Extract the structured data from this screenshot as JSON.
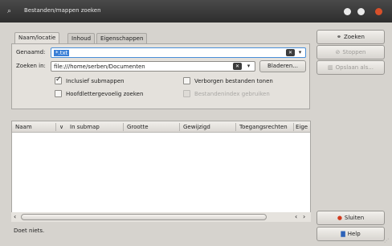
{
  "window": {
    "title": "Bestanden/mappen zoeken",
    "app_icon": "search-window-icon",
    "controls": [
      "minimize-icon",
      "maximize-icon",
      "close-icon"
    ]
  },
  "tabs": [
    {
      "label": "Naam/locatie",
      "active": true
    },
    {
      "label": "Inhoud",
      "active": false
    },
    {
      "label": "Eigenschappen",
      "active": false
    }
  ],
  "form": {
    "name_label": "Genaamd:",
    "name_value": "*.txt",
    "lookin_label": "Zoeken in:",
    "lookin_value": "file:///home/serben/Documenten",
    "browse_button": "Bladeren...",
    "include_subfolders": {
      "label": "Inclusief submappen",
      "checked": true
    },
    "case_sensitive": {
      "label": "Hoofdlettergevoelig zoeken",
      "checked": false
    },
    "hidden_files": {
      "label": "Verborgen bestanden tonen",
      "checked": false
    },
    "use_index": {
      "label": "Bestandenindex gebruiken",
      "checked": false,
      "disabled": true
    }
  },
  "results": {
    "columns": [
      "Naam",
      "In submap",
      "Grootte",
      "Gewijzigd",
      "Toegangsrechten",
      "Eige"
    ]
  },
  "sidebar": {
    "search_button": "Zoeken",
    "stop_button": "Stoppen",
    "save_button": "Opslaan als...",
    "close_button": "Sluiten",
    "help_button": "Help"
  },
  "status": {
    "text": "Doet niets."
  },
  "colors": {
    "accent": "#3a7fd6",
    "close_icon": "#d8502a",
    "titlebar": "#3a3a3a"
  }
}
